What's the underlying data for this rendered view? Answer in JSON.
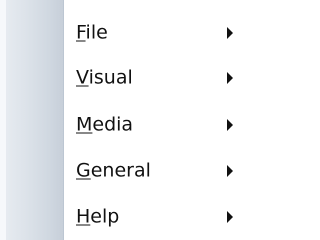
{
  "menu": {
    "items": [
      {
        "label": "File",
        "mnemonic": "F",
        "rest": "ile",
        "has_submenu": true
      },
      {
        "label": "Visual",
        "mnemonic": "V",
        "rest": "isual",
        "has_submenu": true
      },
      {
        "label": "Media",
        "mnemonic": "M",
        "rest": "edia",
        "has_submenu": true
      },
      {
        "label": "General",
        "mnemonic": "G",
        "rest": "eneral",
        "has_submenu": true
      },
      {
        "label": "Help",
        "mnemonic": "H",
        "rest": "elp",
        "has_submenu": true
      }
    ],
    "submenu_arrow_icon": "chevron-right-icon"
  },
  "colors": {
    "background": "#ffffff",
    "gutter": "#d6dde6",
    "text": "#111111"
  }
}
